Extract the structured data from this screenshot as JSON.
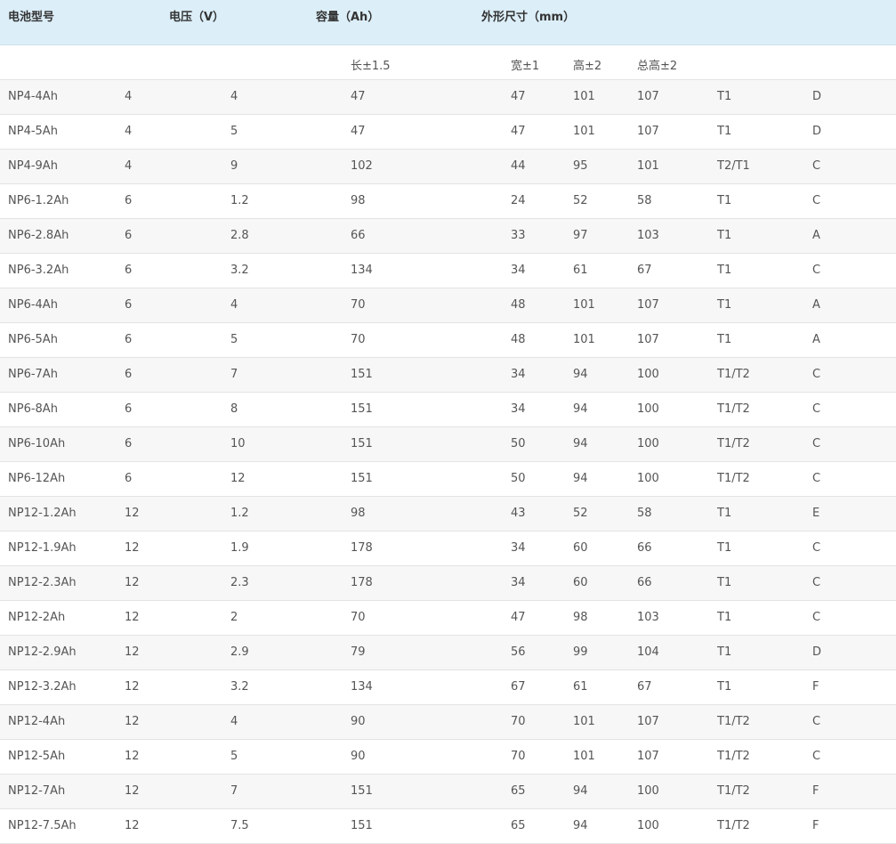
{
  "header": {
    "model": "电池型号",
    "voltage": "电压（V）",
    "capacity": "容量（Ah）",
    "dimensions": "外形尺寸（mm）"
  },
  "subheader": {
    "length": "长±1.5",
    "width": "宽±1",
    "height": "高±2",
    "total_height": "总高±2"
  },
  "rows": [
    [
      "NP4-4Ah",
      "4",
      "4",
      "47",
      "47",
      "101",
      "107",
      "T1",
      "D"
    ],
    [
      "NP4-5Ah",
      "4",
      "5",
      "47",
      "47",
      "101",
      "107",
      "T1",
      "D"
    ],
    [
      "NP4-9Ah",
      "4",
      "9",
      "102",
      "44",
      "95",
      "101",
      "T2/T1",
      "C"
    ],
    [
      "NP6-1.2Ah",
      "6",
      "1.2",
      "98",
      "24",
      "52",
      "58",
      "T1",
      "C"
    ],
    [
      "NP6-2.8Ah",
      "6",
      "2.8",
      "66",
      "33",
      "97",
      "103",
      "T1",
      "A"
    ],
    [
      "NP6-3.2Ah",
      "6",
      "3.2",
      "134",
      "34",
      "61",
      "67",
      "T1",
      "C"
    ],
    [
      "NP6-4Ah",
      "6",
      "4",
      "70",
      "48",
      "101",
      "107",
      "T1",
      "A"
    ],
    [
      "NP6-5Ah",
      "6",
      "5",
      "70",
      "48",
      "101",
      "107",
      "T1",
      "A"
    ],
    [
      "NP6-7Ah",
      "6",
      "7",
      "151",
      "34",
      "94",
      "100",
      "T1/T2",
      "C"
    ],
    [
      "NP6-8Ah",
      "6",
      "8",
      "151",
      "34",
      "94",
      "100",
      "T1/T2",
      "C"
    ],
    [
      "NP6-10Ah",
      "6",
      "10",
      "151",
      "50",
      "94",
      "100",
      "T1/T2",
      "C"
    ],
    [
      "NP6-12Ah",
      "6",
      "12",
      "151",
      "50",
      "94",
      "100",
      "T1/T2",
      "C"
    ],
    [
      "NP12-1.2Ah",
      "12",
      "1.2",
      "98",
      "43",
      "52",
      "58",
      "T1",
      "E"
    ],
    [
      "NP12-1.9Ah",
      "12",
      "1.9",
      "178",
      "34",
      "60",
      "66",
      "T1",
      "C"
    ],
    [
      "NP12-2.3Ah",
      "12",
      "2.3",
      "178",
      "34",
      "60",
      "66",
      "T1",
      "C"
    ],
    [
      "NP12-2Ah",
      "12",
      "2",
      "70",
      "47",
      "98",
      "103",
      "T1",
      "C"
    ],
    [
      "NP12-2.9Ah",
      "12",
      "2.9",
      "79",
      "56",
      "99",
      "104",
      "T1",
      "D"
    ],
    [
      "NP12-3.2Ah",
      "12",
      "3.2",
      "134",
      "67",
      "61",
      "67",
      "T1",
      "F"
    ],
    [
      "NP12-4Ah",
      "12",
      "4",
      "90",
      "70",
      "101",
      "107",
      "T1/T2",
      "C"
    ],
    [
      "NP12-5Ah",
      "12",
      "5",
      "90",
      "70",
      "101",
      "107",
      "T1/T2",
      "C"
    ],
    [
      "NP12-7Ah",
      "12",
      "7",
      "151",
      "65",
      "94",
      "100",
      "T1/T2",
      "F"
    ],
    [
      "NP12-7.5Ah",
      "12",
      "7.5",
      "151",
      "65",
      "94",
      "100",
      "T1/T2",
      "F"
    ]
  ],
  "colors": {
    "header_bg": "#dceef8",
    "row_alt_bg": "#f7f7f7",
    "border": "#e3e3e3"
  }
}
